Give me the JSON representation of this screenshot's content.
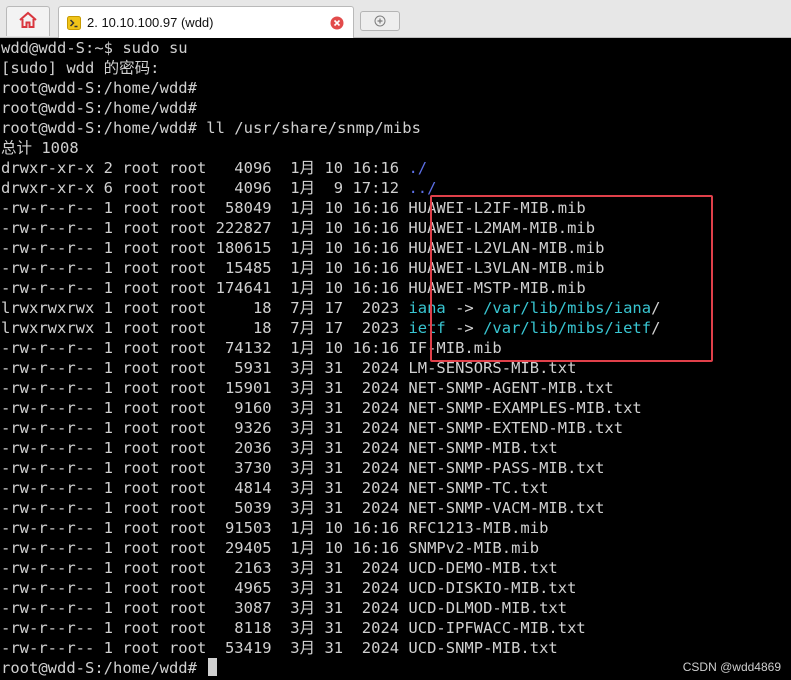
{
  "tabs": {
    "home_icon": "home-icon",
    "active_title": "2. 10.10.100.97 (wdd)",
    "new_tab_icon": "new-tab-icon"
  },
  "terminal": {
    "lines": [
      {
        "t": [
          {
            "s": "wdd@wdd-S:~$ sudo su"
          }
        ]
      },
      {
        "t": [
          {
            "s": "[sudo] wdd 的密码:"
          }
        ]
      },
      {
        "t": [
          {
            "s": "root@wdd-S:/home/wdd#"
          }
        ]
      },
      {
        "t": [
          {
            "s": "root@wdd-S:/home/wdd#"
          }
        ]
      },
      {
        "t": [
          {
            "s": "root@wdd-S:/home/wdd# ll /usr/share/snmp/mibs"
          }
        ]
      },
      {
        "t": [
          {
            "s": "总计 1008"
          }
        ]
      },
      {
        "t": [
          {
            "s": "drwxr-xr-x 2 root root   4096  1月 10 16:16 "
          },
          {
            "s": "./",
            "c": "dir"
          }
        ]
      },
      {
        "t": [
          {
            "s": "drwxr-xr-x 6 root root   4096  1月  9 17:12 "
          },
          {
            "s": "../",
            "c": "dir"
          }
        ]
      },
      {
        "t": [
          {
            "s": "-rw-r--r-- 1 root root  58049  1月 10 16:16 HUAWEI-L2IF-MIB.mib"
          }
        ]
      },
      {
        "t": [
          {
            "s": "-rw-r--r-- 1 root root 222827  1月 10 16:16 HUAWEI-L2MAM-MIB.mib"
          }
        ]
      },
      {
        "t": [
          {
            "s": "-rw-r--r-- 1 root root 180615  1月 10 16:16 HUAWEI-L2VLAN-MIB.mib"
          }
        ]
      },
      {
        "t": [
          {
            "s": "-rw-r--r-- 1 root root  15485  1月 10 16:16 HUAWEI-L3VLAN-MIB.mib"
          }
        ]
      },
      {
        "t": [
          {
            "s": "-rw-r--r-- 1 root root 174641  1月 10 16:16 HUAWEI-MSTP-MIB.mib"
          }
        ]
      },
      {
        "t": [
          {
            "s": "lrwxrwxrwx 1 root root     18  7月 17  2023 "
          },
          {
            "s": "iana",
            "c": "link"
          },
          {
            "s": " -> "
          },
          {
            "s": "/var/lib/mibs/iana",
            "c": "link"
          },
          {
            "s": "/"
          }
        ]
      },
      {
        "t": [
          {
            "s": "lrwxrwxrwx 1 root root     18  7月 17  2023 "
          },
          {
            "s": "ietf",
            "c": "link"
          },
          {
            "s": " -> "
          },
          {
            "s": "/var/lib/mibs/ietf",
            "c": "link"
          },
          {
            "s": "/"
          }
        ]
      },
      {
        "t": [
          {
            "s": "-rw-r--r-- 1 root root  74132  1月 10 16:16 IF-MIB.mib"
          }
        ]
      },
      {
        "t": [
          {
            "s": "-rw-r--r-- 1 root root   5931  3月 31  2024 LM-SENSORS-MIB.txt"
          }
        ]
      },
      {
        "t": [
          {
            "s": "-rw-r--r-- 1 root root  15901  3月 31  2024 NET-SNMP-AGENT-MIB.txt"
          }
        ]
      },
      {
        "t": [
          {
            "s": "-rw-r--r-- 1 root root   9160  3月 31  2024 NET-SNMP-EXAMPLES-MIB.txt"
          }
        ]
      },
      {
        "t": [
          {
            "s": "-rw-r--r-- 1 root root   9326  3月 31  2024 NET-SNMP-EXTEND-MIB.txt"
          }
        ]
      },
      {
        "t": [
          {
            "s": "-rw-r--r-- 1 root root   2036  3月 31  2024 NET-SNMP-MIB.txt"
          }
        ]
      },
      {
        "t": [
          {
            "s": "-rw-r--r-- 1 root root   3730  3月 31  2024 NET-SNMP-PASS-MIB.txt"
          }
        ]
      },
      {
        "t": [
          {
            "s": "-rw-r--r-- 1 root root   4814  3月 31  2024 NET-SNMP-TC.txt"
          }
        ]
      },
      {
        "t": [
          {
            "s": "-rw-r--r-- 1 root root   5039  3月 31  2024 NET-SNMP-VACM-MIB.txt"
          }
        ]
      },
      {
        "t": [
          {
            "s": "-rw-r--r-- 1 root root  91503  1月 10 16:16 RFC1213-MIB.mib"
          }
        ]
      },
      {
        "t": [
          {
            "s": "-rw-r--r-- 1 root root  29405  1月 10 16:16 SNMPv2-MIB.mib"
          }
        ]
      },
      {
        "t": [
          {
            "s": "-rw-r--r-- 1 root root   2163  3月 31  2024 UCD-DEMO-MIB.txt"
          }
        ]
      },
      {
        "t": [
          {
            "s": "-rw-r--r-- 1 root root   4965  3月 31  2024 UCD-DISKIO-MIB.txt"
          }
        ]
      },
      {
        "t": [
          {
            "s": "-rw-r--r-- 1 root root   3087  3月 31  2024 UCD-DLMOD-MIB.txt"
          }
        ]
      },
      {
        "t": [
          {
            "s": "-rw-r--r-- 1 root root   8118  3月 31  2024 UCD-IPFWACC-MIB.txt"
          }
        ]
      },
      {
        "t": [
          {
            "s": "-rw-r--r-- 1 root root  53419  3月 31  2024 UCD-SNMP-MIB.txt"
          }
        ]
      },
      {
        "t": [
          {
            "s": "root@wdd-S:/home/wdd# "
          }
        ],
        "cursor": true
      }
    ],
    "highlight_color": "#e0404a",
    "dir_color": "#5c6fe6",
    "link_color": "#38c5d1"
  },
  "watermark": "CSDN @wdd4869"
}
